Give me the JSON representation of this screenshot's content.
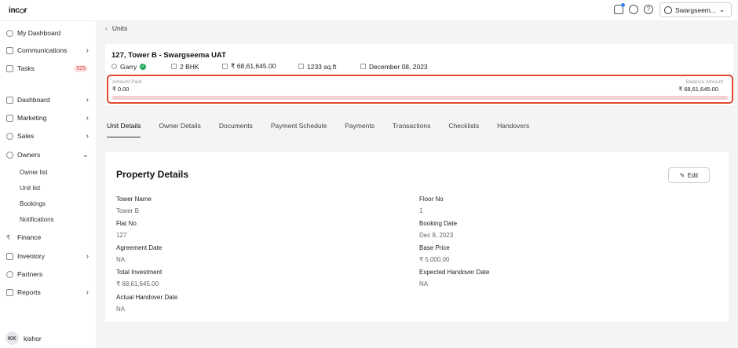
{
  "app": {
    "logo": "inc",
    "logo_tail": "r"
  },
  "header": {
    "project_name": "Swargseem...",
    "help_icon_glyph": "?"
  },
  "sidebar": {
    "items_top": [
      {
        "label": "My Dashboard",
        "icon": "user-icon"
      },
      {
        "label": "Communications",
        "icon": "chat-icon",
        "chevron": "›"
      },
      {
        "label": "Tasks",
        "icon": "calendar-icon",
        "badge": "525"
      }
    ],
    "items_main": [
      {
        "label": "Dashboard",
        "icon": "chart-icon",
        "chevron": "›"
      },
      {
        "label": "Marketing",
        "icon": "megaphone-icon",
        "chevron": "›"
      },
      {
        "label": "Sales",
        "icon": "sales-icon",
        "chevron": "›"
      },
      {
        "label": "Owners",
        "icon": "owners-icon",
        "chevron": "⌄"
      }
    ],
    "owners_sub": [
      "Owner list",
      "Unit list",
      "Bookings",
      "Notifications"
    ],
    "items_bottom": [
      {
        "label": "Finance",
        "icon": "rupee-icon"
      },
      {
        "label": "Inventory",
        "icon": "building-icon",
        "chevron": "›"
      },
      {
        "label": "Partners",
        "icon": "partners-icon"
      },
      {
        "label": "Reports",
        "icon": "reports-icon",
        "chevron": "›"
      }
    ],
    "user": {
      "initials": "KK",
      "name": "kishor"
    }
  },
  "breadcrumb": {
    "back": "‹",
    "label": "Units"
  },
  "unit": {
    "title": "127, Tower B - Swargseema UAT",
    "owner": "Garry",
    "config": "2 BHK",
    "price": "₹ 68,61,645.00",
    "area": "1233 sq.ft",
    "date": "December 08, 2023"
  },
  "payment": {
    "paid_label": "Amount Paid",
    "paid_value": "₹ 0.00",
    "balance_label": "Balance Amount",
    "balance_value": "₹ 68,61,645.00",
    "progress_fraction": 0.0,
    "accent_color": "#e0492b"
  },
  "tabs": [
    {
      "label": "Unit Details",
      "active": true
    },
    {
      "label": "Owner Details"
    },
    {
      "label": "Documents"
    },
    {
      "label": "Payment Schedule"
    },
    {
      "label": "Payments"
    },
    {
      "label": "Transactions"
    },
    {
      "label": "Checklists"
    },
    {
      "label": "Handovers"
    }
  ],
  "details": {
    "title": "Property Details",
    "edit_label": "Edit",
    "left": [
      {
        "label": "Tower Name",
        "value": "Tower B"
      },
      {
        "label": "Flat No",
        "value": "127"
      },
      {
        "label": "Agreement Date",
        "value": "NA"
      },
      {
        "label": "Total Investment",
        "value": "₹ 68,61,645.00"
      },
      {
        "label": "Actual Handover Date",
        "value": "NA"
      }
    ],
    "right": [
      {
        "label": "Floor No",
        "value": "1"
      },
      {
        "label": "Booking Date",
        "value": "Dec 8, 2023"
      },
      {
        "label": "Base Price",
        "value": "₹ 5,000.00"
      },
      {
        "label": "Expected Handover Date",
        "value": "NA"
      }
    ]
  }
}
